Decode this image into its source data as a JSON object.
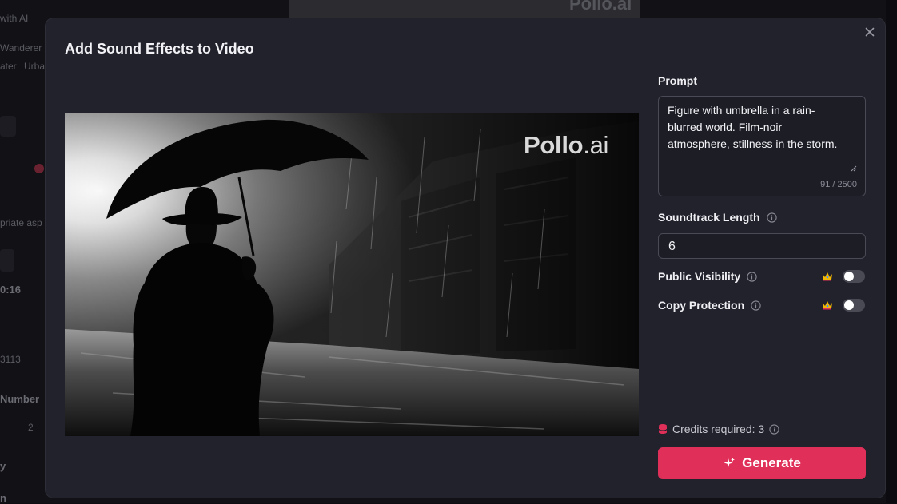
{
  "background": {
    "fragments": [
      "with AI",
      "Wanderer",
      "ater",
      "Urba",
      "priate asp",
      "0:16",
      "3113",
      "Number",
      "2",
      "y",
      "n"
    ],
    "watermark": "Pollo.ai"
  },
  "modal": {
    "title": "Add Sound Effects to Video",
    "close_icon": "close-icon",
    "preview": {
      "watermark_bold": "Pollo",
      "watermark_light": ".ai"
    },
    "prompt": {
      "label": "Prompt",
      "value": "Figure with umbrella in a rain-blurred world. Film-noir atmosphere, stillness in the storm.",
      "char_count": "91 / 2500"
    },
    "soundtrack_length": {
      "label": "Soundtrack Length",
      "value": "6",
      "info_icon": "info-icon"
    },
    "public_visibility": {
      "label": "Public Visibility",
      "enabled": false,
      "premium_icon": "crown-icon"
    },
    "copy_protection": {
      "label": "Copy Protection",
      "enabled": false,
      "premium_icon": "crown-icon"
    },
    "credits": {
      "text": "Credits required: 3",
      "icon": "coins-icon"
    },
    "generate": {
      "label": "Generate",
      "icon": "sparkle-icon"
    }
  },
  "colors": {
    "accent": "#e0305a",
    "modal_bg": "#22222c",
    "toggle_off": "#4a4a55"
  }
}
